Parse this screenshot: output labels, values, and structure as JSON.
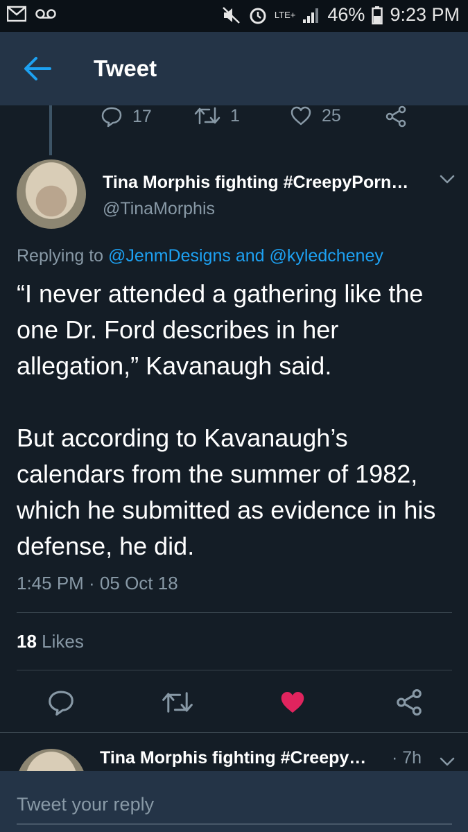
{
  "status_bar": {
    "battery": "46%",
    "network": "LTE+",
    "time": "9:23 PM"
  },
  "header": {
    "title": "Tweet"
  },
  "previous_tweet_actions": {
    "replies": "17",
    "retweets": "1",
    "likes": "25"
  },
  "tweet": {
    "author_name": "Tina Morphis fighting #CreepyPorn…",
    "author_handle": "@TinaMorphis",
    "replying_prefix": "Replying to",
    "mention_1": "@JenmDesigns",
    "replying_and": "and",
    "mention_2": "@kyledcheney",
    "text": "“I never attended a gathering like the one Dr. Ford describes in her allegation,” Kavanaugh said.\n\nBut according to Kavanaugh’s calendars from the summer of 1982, which he submitted as evidence in his defense, he did.",
    "timestamp": "1:45 PM · 05 Oct 18",
    "likes_count": "18",
    "likes_label": "Likes",
    "liked": true
  },
  "next_tweet": {
    "author_name": "Tina Morphis fighting #Creepy…",
    "time": "· 7h"
  },
  "reply_box": {
    "placeholder": "Tweet your reply"
  },
  "colors": {
    "background": "#141d26",
    "app_bar": "#243447",
    "accent": "#1da1f2",
    "secondary_text": "#8899a6",
    "like": "#e0245e"
  },
  "icons": {
    "status_left": [
      "gmail-icon",
      "voicemail-icon"
    ],
    "status_right": [
      "mute-icon",
      "alarm-icon",
      "signal-icon",
      "battery-icon"
    ],
    "tweet_actions": [
      "reply-icon",
      "retweet-icon",
      "like-icon",
      "share-icon"
    ]
  }
}
